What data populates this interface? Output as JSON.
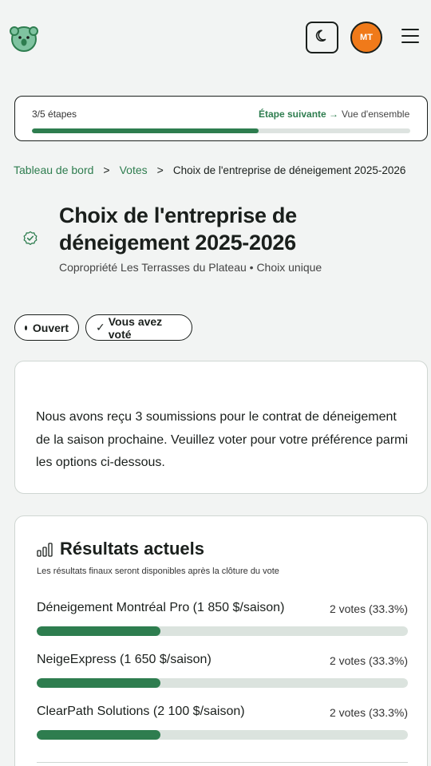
{
  "header": {
    "logo_icon": "koala-logo-icon",
    "theme_icon": "moon-icon",
    "avatar_initials": "MT",
    "menu_icon": "hamburger-menu-icon"
  },
  "progress": {
    "steps_label": "3/5 étapes",
    "next_label": "Étape suivante →",
    "overview_label": "Vue d'ensemble",
    "fraction": 0.6
  },
  "breadcrumb": {
    "items": [
      "Tableau de bord",
      "Votes"
    ],
    "separator": ">",
    "current": "Choix de l'entreprise de déneigement 2025-2026"
  },
  "vote": {
    "title": "Choix de l'entreprise de déneigement 2025-2026",
    "subtitle": "Copropriété Les Terrasses du Plateau • Choix unique",
    "status_icon": "check-circle-icon"
  },
  "pills": {
    "open": "Ouvert",
    "voted": "Vous avez voté",
    "voted_check": "✓"
  },
  "description": "Nous avons reçu 3 soumissions pour le contrat de déneigement de la saison prochaine. Veuillez voter pour votre préférence parmi les options ci-dessous.",
  "results": {
    "icon": "bar-chart-icon",
    "title": "Résultats actuels",
    "note": "Les résultats finaux seront disponibles après la clôture du vote",
    "options": [
      {
        "label": "Déneigement Montréal Pro (1 850 $/saison)",
        "votes": "2 votes (33.3%)",
        "percent": 33.3
      },
      {
        "label": "NeigeExpress (1 650 $/saison)",
        "votes": "2 votes (33.3%)",
        "percent": 33.3
      },
      {
        "label": "ClearPath Solutions (2 100 $/saison)",
        "votes": "2 votes (33.3%)",
        "percent": 33.3
      }
    ]
  },
  "colors": {
    "accent": "#2e7d4f",
    "avatar": "#f07a1a",
    "background": "#f2f4f3"
  }
}
